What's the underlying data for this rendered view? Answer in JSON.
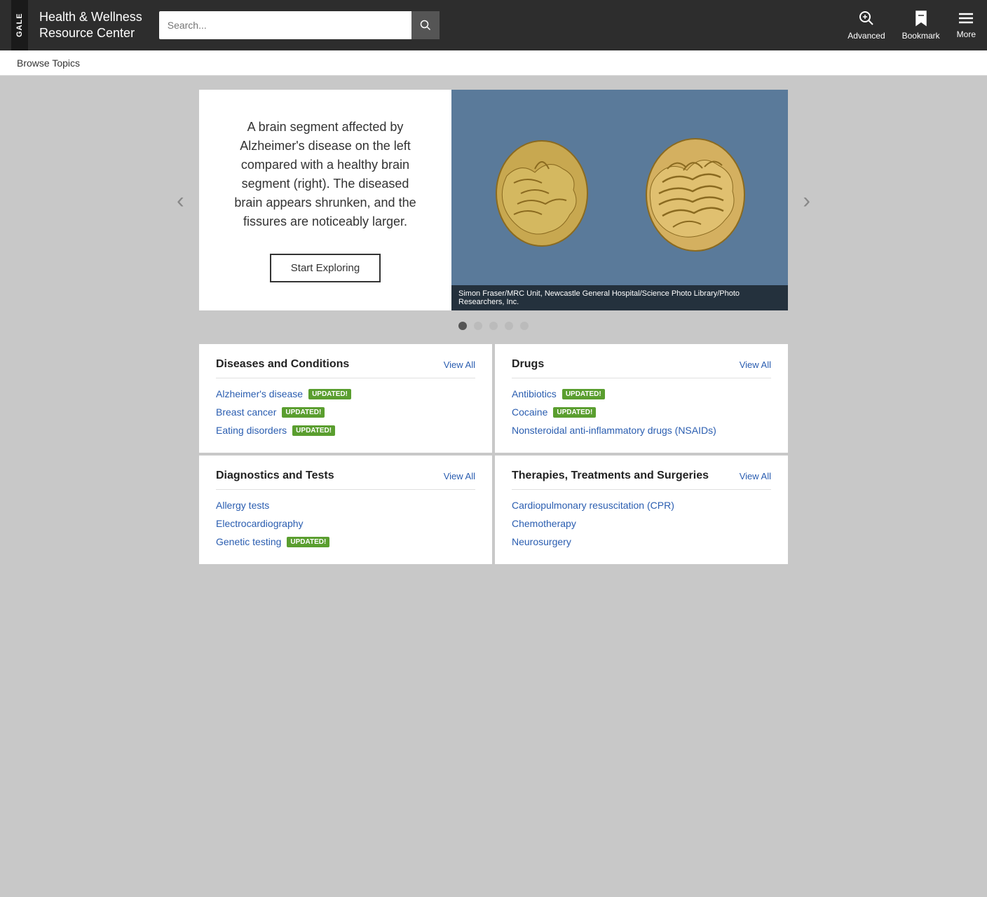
{
  "header": {
    "logo": "GALE",
    "title_line1": "Health & Wellness",
    "title_line2": "Resource Center",
    "search_placeholder": "Search...",
    "actions": [
      {
        "id": "advanced",
        "label": "Advanced",
        "icon": "🔍"
      },
      {
        "id": "bookmark",
        "label": "Bookmark",
        "icon": "🔖"
      },
      {
        "id": "more",
        "label": "More",
        "icon": "☰"
      }
    ]
  },
  "subnav": {
    "items": [
      {
        "id": "browse-topics",
        "label": "Browse Topics"
      }
    ]
  },
  "carousel": {
    "slide": {
      "text": "A brain segment affected by Alzheimer's disease on the left compared with a healthy brain segment (right). The diseased brain appears shrunken, and the fissures are noticeably larger.",
      "button_label": "Start Exploring",
      "caption": "Simon Fraser/MRC Unit, Newcastle General Hospital/Science Photo Library/Photo Researchers, Inc."
    },
    "dots": [
      {
        "active": true
      },
      {
        "active": false
      },
      {
        "active": false
      },
      {
        "active": false
      },
      {
        "active": false
      }
    ],
    "prev_label": "‹",
    "next_label": "›"
  },
  "categories": [
    {
      "id": "diseases-conditions",
      "title": "Diseases and Conditions",
      "view_all_label": "View All",
      "links": [
        {
          "text": "Alzheimer's disease",
          "updated": true
        },
        {
          "text": "Breast cancer",
          "updated": true
        },
        {
          "text": "Eating disorders",
          "updated": true
        }
      ]
    },
    {
      "id": "drugs",
      "title": "Drugs",
      "view_all_label": "View All",
      "links": [
        {
          "text": "Antibiotics",
          "updated": true
        },
        {
          "text": "Cocaine",
          "updated": true
        },
        {
          "text": "Nonsteroidal anti-inflammatory drugs (NSAIDs)",
          "updated": false
        }
      ]
    },
    {
      "id": "diagnostics-tests",
      "title": "Diagnostics and Tests",
      "view_all_label": "View All",
      "links": [
        {
          "text": "Allergy tests",
          "updated": false
        },
        {
          "text": "Electrocardiography",
          "updated": false
        },
        {
          "text": "Genetic testing",
          "updated": true
        }
      ]
    },
    {
      "id": "therapies-treatments",
      "title": "Therapies, Treatments and Surgeries",
      "view_all_label": "View All",
      "links": [
        {
          "text": "Cardiopulmonary resuscitation (CPR)",
          "updated": false
        },
        {
          "text": "Chemotherapy",
          "updated": false
        },
        {
          "text": "Neurosurgery",
          "updated": false
        }
      ]
    }
  ],
  "updated_badge_label": "UPDATED!"
}
